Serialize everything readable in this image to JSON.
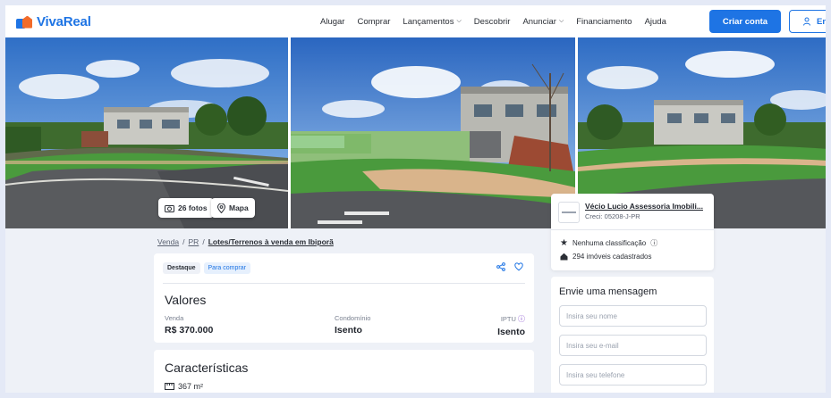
{
  "header": {
    "logo_text": "VivaReal",
    "nav": [
      "Alugar",
      "Comprar",
      "Lançamentos",
      "Descobrir",
      "Anunciar",
      "Financiamento",
      "Ajuda"
    ],
    "nav_dropdowns": [
      "Lançamentos",
      "Anunciar"
    ],
    "create_account": "Criar conta",
    "login": "Entrar",
    "brand_color": "#1e74e4",
    "accent_color": "#f26b2a"
  },
  "gallery": {
    "photos_button": "26 fotos",
    "map_button": "Mapa"
  },
  "breadcrumb": {
    "items": [
      "Venda",
      "PR",
      "Lotes/Terrenos à venda em Ibiporã"
    ],
    "separator": "/"
  },
  "listing": {
    "badges": [
      "Destaque",
      "Para comprar"
    ],
    "values_title": "Valores",
    "sale_label": "Venda",
    "sale_value": "R$ 370.000",
    "condo_label": "Condomínio",
    "condo_value": "Isento",
    "iptu_label": "IPTU",
    "iptu_value": "Isento",
    "features_title": "Características",
    "area": "367 m²"
  },
  "agent": {
    "name": "Vécio Lucio Assessoria Imobili...",
    "creci": "Creci: 05208-J-PR",
    "rating": "Nenhuma classificação",
    "listings": "294 imóveis cadastrados"
  },
  "message_form": {
    "title": "Envie uma mensagem",
    "name_placeholder": "Insira seu nome",
    "email_placeholder": "Insira seu e-mail",
    "phone_placeholder": "Insira seu telefone"
  }
}
